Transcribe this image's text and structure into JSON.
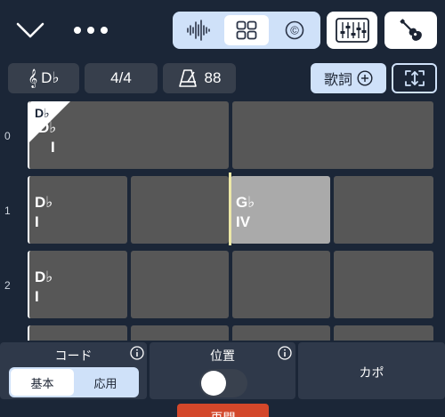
{
  "header": {
    "icons": {
      "collapse": "chevron-down-icon",
      "more": "more-dots-icon",
      "waveform": "waveform-icon",
      "grid": "grid-icon",
      "copyright": "copyright-icon",
      "mixer": "mixer-icon",
      "instrument": "guitar-icon"
    },
    "copyright_glyph": "©",
    "active_view": "grid"
  },
  "info_bar": {
    "key": "D♭",
    "time_signature": "4/4",
    "tempo": "88",
    "lyrics_label": "歌詞"
  },
  "grid": {
    "rows": [
      {
        "number": "0",
        "cells": [
          {
            "chord": "D♭",
            "roman": "I",
            "marker": "D♭",
            "start": true
          },
          {
            "chord": "",
            "roman": ""
          }
        ]
      },
      {
        "number": "1",
        "cells": [
          {
            "chord": "D♭",
            "roman": "I",
            "start": true
          },
          {
            "chord": "",
            "roman": ""
          },
          {
            "chord": "G♭",
            "roman": "IV",
            "selected": true
          },
          {
            "chord": "",
            "roman": ""
          }
        ]
      },
      {
        "number": "2",
        "cells": [
          {
            "chord": "D♭",
            "roman": "I",
            "start": true
          },
          {
            "chord": "",
            "roman": ""
          },
          {
            "chord": "",
            "roman": ""
          },
          {
            "chord": "",
            "roman": ""
          }
        ]
      }
    ]
  },
  "bottom_panel": {
    "chord": {
      "title": "コード",
      "options": [
        "基本",
        "応用"
      ],
      "selected": "基本"
    },
    "position": {
      "title": "位置",
      "toggle_on": false
    },
    "capo": {
      "title": "カポ"
    },
    "resume_label": "再開"
  },
  "colors": {
    "background": "#1b2637",
    "accent": "#cfe1f9",
    "cell": "#575757",
    "cell_selected": "#aaaaaa",
    "cursor": "#ede8a7",
    "resume": "#d3472a"
  }
}
